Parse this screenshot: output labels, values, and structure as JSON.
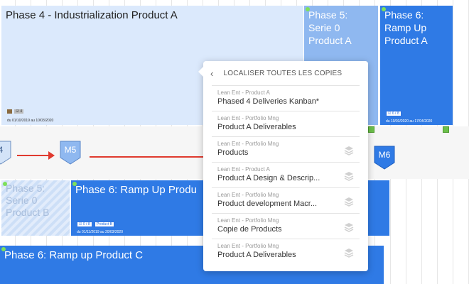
{
  "cards": {
    "phase4": {
      "title": "Phase 4 - Industrialization Product A",
      "meta_count": "4",
      "meta_dates": "du 01/10/2019 au 10/03/2020"
    },
    "phase5a": {
      "title_l1": "Phase 5:",
      "title_l2": "Serie 0",
      "title_l3": "Product A"
    },
    "phase6a": {
      "title_l1": "Phase 6:",
      "title_l2": "Ramp Up",
      "title_l3": "Product A",
      "meta_count": "6 / 8",
      "meta_dates": "du 10/03/2020 au 17/04/2020"
    },
    "phase5b": {
      "title_l1": "Phase 5:",
      "title_l2": "Serie 0",
      "title_l3": "Product B"
    },
    "phase6b": {
      "title": "Phase 6: Ramp Up Produ",
      "meta_count": "0 / 8",
      "meta_tag": "Product B",
      "meta_dates": "du 01/11/2019 au 20/03/2020"
    },
    "phase6c": {
      "title": "Phase 6: Ramp up Product C"
    }
  },
  "milestones": {
    "m4": "4",
    "m5": "M5",
    "m6": "M6"
  },
  "popup": {
    "header": "LOCALISER TOUTES LES COPIES",
    "items": [
      {
        "source": "Lean Ent - Product A",
        "name": "Phased 4 Deliveries Kanban*"
      },
      {
        "source": "Lean Ent - Portfolio Mng",
        "name": "Product A Deliverables"
      },
      {
        "source": "Lean Ent - Portfolio Mng",
        "name": "Products"
      },
      {
        "source": "Lean Ent - Product A",
        "name": "Product A Design & Descrip..."
      },
      {
        "source": "Lean Ent - Portfolio Mng",
        "name": "Product development Macr..."
      },
      {
        "source": "Lean Ent - Portfolio Mng",
        "name": "Copie de Products"
      },
      {
        "source": "Lean Ent - Portfolio Mng",
        "name": "Product A Deliverables"
      }
    ]
  },
  "colors": {
    "blue": "#2f7ae5",
    "light_blue": "#dbe9fc",
    "mid_blue": "#8fb8f0",
    "red": "#e03a2f",
    "green": "#6cc04a"
  }
}
